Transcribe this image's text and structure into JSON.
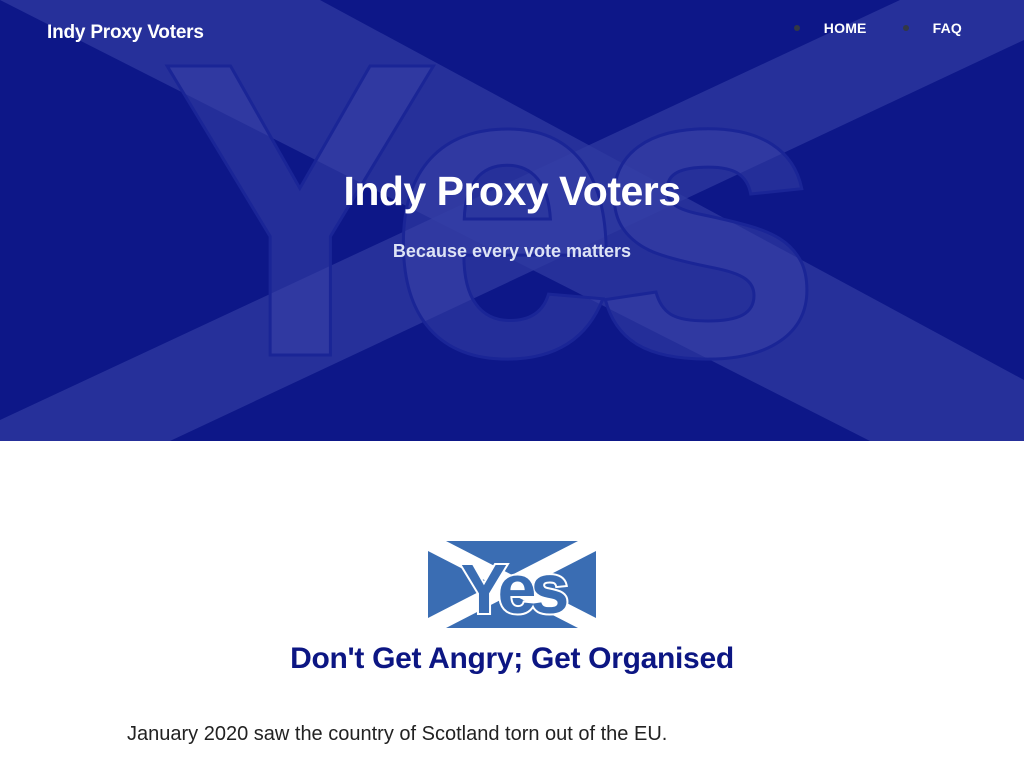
{
  "header": {
    "brand": "Indy Proxy Voters",
    "nav": [
      {
        "label": "HOME"
      },
      {
        "label": "FAQ"
      }
    ]
  },
  "hero": {
    "title": "Indy Proxy Voters",
    "subtitle": "Because every vote matters",
    "watermark_text": "Yes"
  },
  "main": {
    "logo_text": "Yes",
    "heading": "Don't Get Angry; Get Organised",
    "paragraph": "January 2020 saw the country of Scotland torn out of the EU."
  },
  "colors": {
    "hero_background": "#0d1788",
    "saltire_overlay": "#3a45a6",
    "heading": "#0c1683",
    "logo_flag": "#3a6db3"
  }
}
